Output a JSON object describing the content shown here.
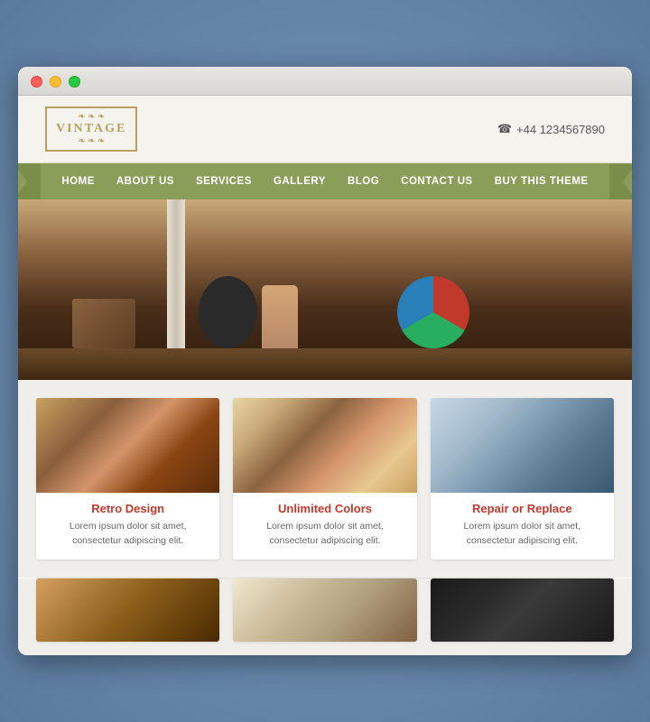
{
  "browser": {
    "traffic_lights": [
      "red",
      "yellow",
      "green"
    ]
  },
  "header": {
    "logo_text": "VINTAGE",
    "logo_ornament": "❧ ❧ ❧",
    "phone_icon": "☎",
    "phone_number": "+44 1234567890"
  },
  "nav": {
    "items": [
      {
        "label": "HOME",
        "active": true
      },
      {
        "label": "ABOUT US",
        "active": false
      },
      {
        "label": "SERVICES",
        "active": false
      },
      {
        "label": "GALLERY",
        "active": false
      },
      {
        "label": "BLOG",
        "active": false
      },
      {
        "label": "CONTACT US",
        "active": false
      },
      {
        "label": "BUY THIS THEME",
        "active": false
      }
    ]
  },
  "cards": [
    {
      "title": "Retro Design",
      "text": "Lorem ipsum dolor sit amet, consectetur adipiscing elit.",
      "img_class": "img-retro"
    },
    {
      "title": "Unlimited Colors",
      "text": "Lorem ipsum dolor sit amet, consectetur adipiscing elit.",
      "img_class": "img-colors"
    },
    {
      "title": "Repair or Replace",
      "text": "Lorem ipsum dolor sit amet, consectetur adipiscing elit.",
      "img_class": "img-repair"
    }
  ],
  "bottom_cards": [
    {
      "img_class": "img-bottom1"
    },
    {
      "img_class": "img-bottom2"
    },
    {
      "img_class": "img-bottom3"
    }
  ]
}
